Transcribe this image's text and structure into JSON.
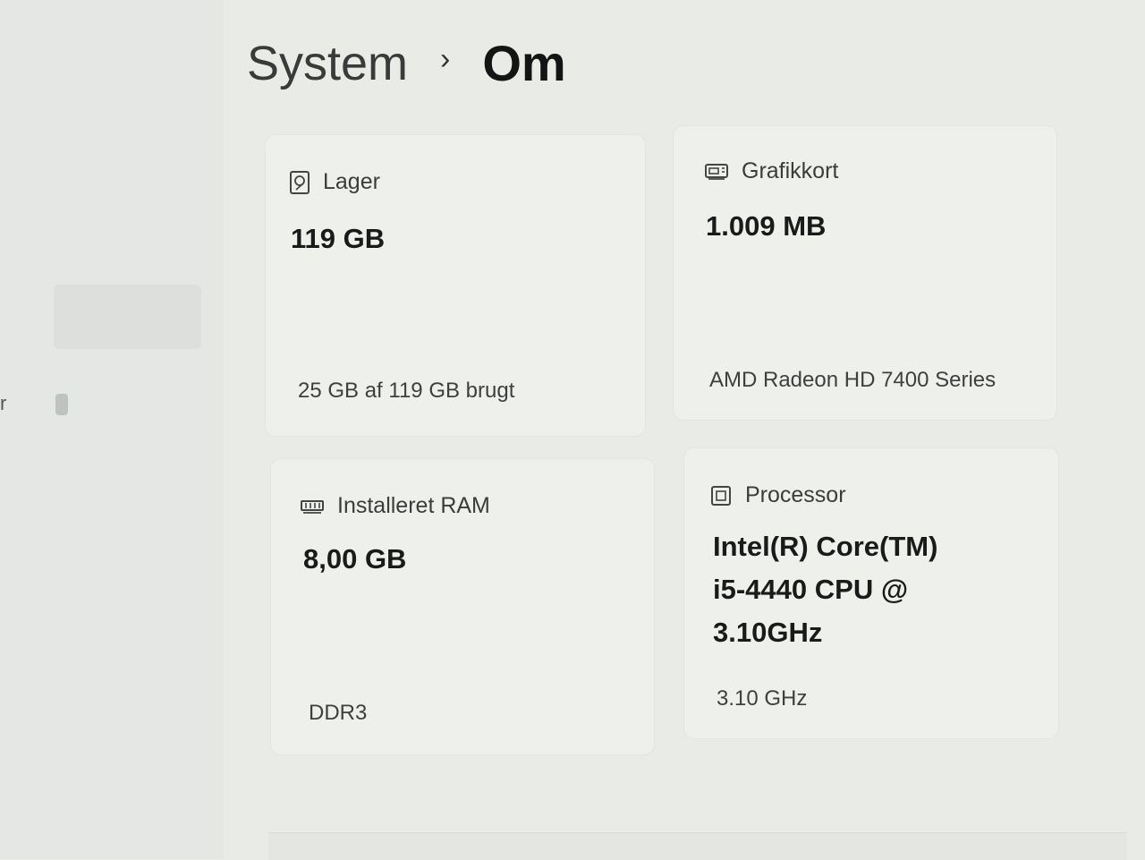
{
  "breadcrumb": {
    "parent": "System",
    "separator": "›",
    "current": "Om"
  },
  "sidebar": {
    "partial_label": "r"
  },
  "cards": [
    {
      "id": "storage",
      "icon": "hard-drive-icon",
      "title": "Lager",
      "value": "119 GB",
      "detail": "25 GB af 119 GB brugt"
    },
    {
      "id": "graphics",
      "icon": "graphics-card-icon",
      "title": "Grafikkort",
      "value": "1.009 MB",
      "detail": "AMD Radeon HD 7400 Series"
    },
    {
      "id": "ram",
      "icon": "memory-icon",
      "title": "Installeret RAM",
      "value": "8,00 GB",
      "detail": "DDR3"
    },
    {
      "id": "processor",
      "icon": "processor-icon",
      "title": "Processor",
      "value_lines": [
        "Intel(R) Core(TM)",
        "i5-4440 CPU @",
        "3.10GHz"
      ],
      "detail": "3.10 GHz"
    }
  ]
}
